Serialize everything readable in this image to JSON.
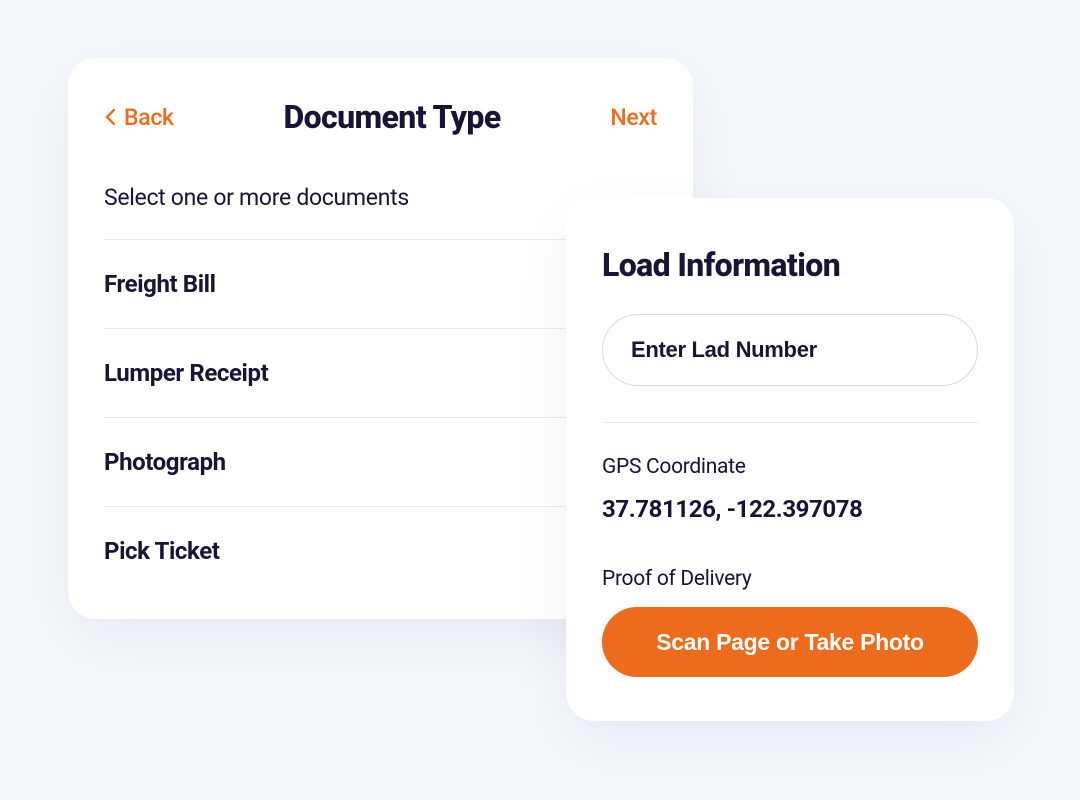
{
  "docCard": {
    "back": "Back",
    "title": "Document Type",
    "next": "Next",
    "subtitle": "Select one or more documents",
    "items": [
      "Freight Bill",
      "Lumper Receipt",
      "Photograph",
      "Pick Ticket"
    ]
  },
  "loadCard": {
    "title": "Load Information",
    "inputPlaceholder": "Enter Lad Number",
    "gpsLabel": "GPS Coordinate",
    "gpsValue": "37.781126, -122.397078",
    "proofLabel": "Proof of Delivery",
    "scanButton": "Scan Page or Take Photo"
  }
}
